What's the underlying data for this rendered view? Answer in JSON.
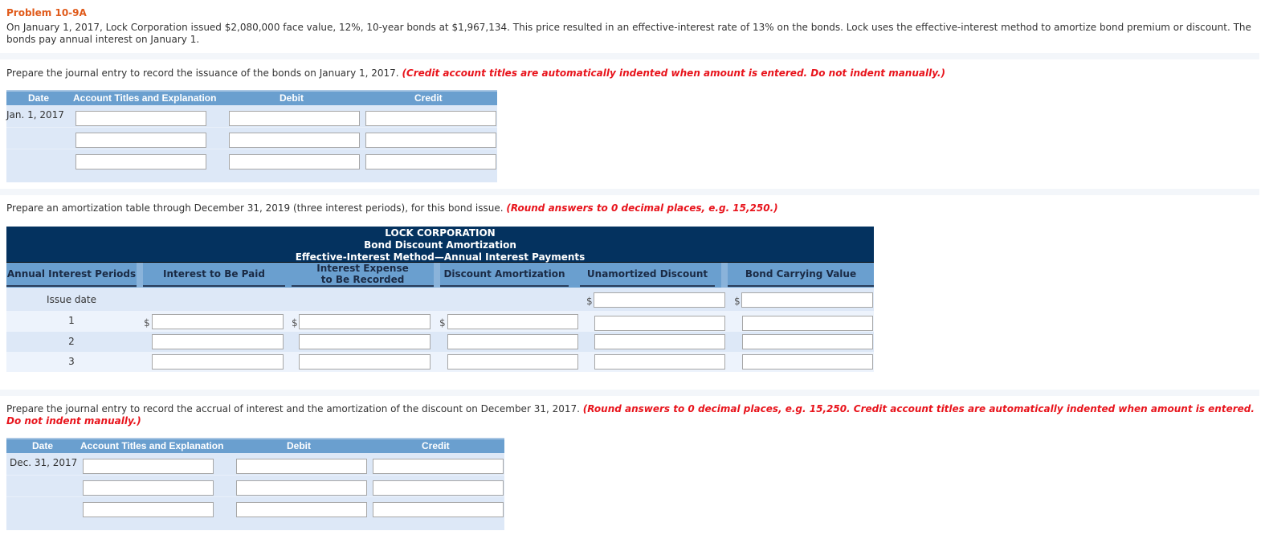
{
  "problem": {
    "title": "Problem 10-9A",
    "text": "On January 1, 2017, Lock Corporation issued $2,080,000 face value, 12%, 10-year bonds at $1,967,134. This price resulted in an effective-interest rate of 13% on the bonds. Lock uses the effective-interest method to amortize bond premium or discount. The bonds pay annual interest on January 1."
  },
  "part1": {
    "instruction": "Prepare the journal entry to record the issuance of the bonds on January 1, 2017.",
    "note": "(Credit account titles are automatically indented when amount is entered. Do not indent manually.)",
    "headers": {
      "date": "Date",
      "account": "Account Titles and Explanation",
      "debit": "Debit",
      "credit": "Credit"
    },
    "date": "Jan. 1, 2017",
    "rows": [
      {
        "account": "",
        "debit": "",
        "credit": ""
      },
      {
        "account": "",
        "debit": "",
        "credit": ""
      },
      {
        "account": "",
        "debit": "",
        "credit": ""
      }
    ]
  },
  "part2": {
    "instruction": "Prepare an amortization table through December 31, 2019 (three interest periods), for this bond issue.",
    "note": "(Round answers to 0 decimal places, e.g. 15,250.)",
    "title_lines": [
      "LOCK CORPORATION",
      "Bond Discount Amortization",
      "Effective-Interest Method—Annual Interest Payments"
    ],
    "columns": {
      "periods": "Annual Interest Periods",
      "interest_paid": "Interest to Be Paid",
      "interest_expense_1": "Interest Expense",
      "interest_expense_2": "to Be Recorded",
      "discount_amortization": "Discount Amortization",
      "unamortized_discount": "Unamortized Discount",
      "carrying_value": "Bond Carrying Value"
    },
    "currency_symbol": "$",
    "rows": [
      {
        "label": "Issue date",
        "unamortized_discount": "",
        "carrying_value": ""
      },
      {
        "label": "1",
        "interest_paid": "",
        "interest_expense": "",
        "discount_amortization": "",
        "unamortized_discount": "",
        "carrying_value": ""
      },
      {
        "label": "2",
        "interest_paid": "",
        "interest_expense": "",
        "discount_amortization": "",
        "unamortized_discount": "",
        "carrying_value": ""
      },
      {
        "label": "3",
        "interest_paid": "",
        "interest_expense": "",
        "discount_amortization": "",
        "unamortized_discount": "",
        "carrying_value": ""
      }
    ]
  },
  "part3": {
    "instruction": "Prepare the journal entry to record the accrual of interest and the amortization of the discount on December 31, 2017.",
    "note": "(Round answers to 0 decimal places, e.g. 15,250. Credit account titles are automatically indented when amount is entered. Do not indent manually.)",
    "headers": {
      "date": "Date",
      "account": "Account Titles and Explanation",
      "debit": "Debit",
      "credit": "Credit"
    },
    "date": "Dec. 31, 2017",
    "rows": [
      {
        "account": "",
        "debit": "",
        "credit": ""
      },
      {
        "account": "",
        "debit": "",
        "credit": ""
      },
      {
        "account": "",
        "debit": "",
        "credit": ""
      }
    ]
  },
  "colors": {
    "problem_title": "#e05a1a",
    "note_red": "#e8141c",
    "table_header_blue": "#6a9fcf",
    "table_title_navy": "#04325f",
    "row_light_blue": "#dde8f7"
  }
}
